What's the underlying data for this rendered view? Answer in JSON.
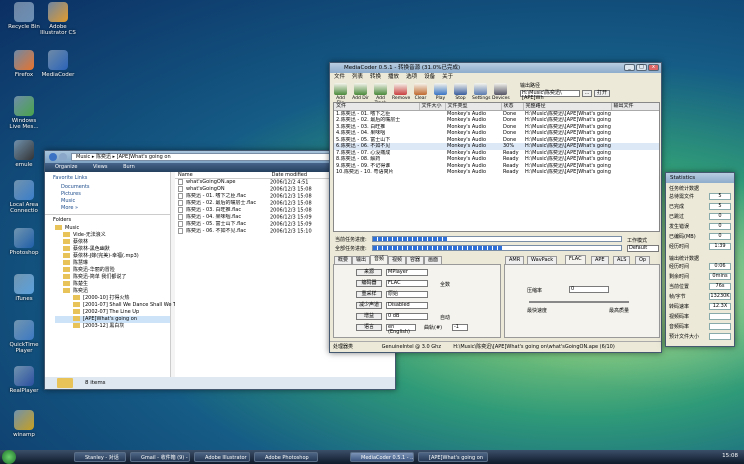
{
  "desktop_icons": [
    {
      "label": "Recycle Bin",
      "color": "#6c8fb5"
    },
    {
      "label": "Adobe Illustrator CS",
      "color": "#e39b2b"
    },
    {
      "label": "Firefox",
      "color": "#e8732c"
    },
    {
      "label": "MediaCoder",
      "color": "#2a62b8"
    },
    {
      "label": "Windows Live Mes...",
      "color": "#49a34a"
    },
    {
      "label": "emule",
      "color": "#333333"
    },
    {
      "label": "Local Area Connectio",
      "color": "#3a7dc9"
    },
    {
      "label": "Photoshop",
      "color": "#1f5ea8"
    },
    {
      "label": "iTunes",
      "color": "#5aa0dd"
    },
    {
      "label": "QuickTime Player",
      "color": "#3b78c2"
    },
    {
      "label": "RealPlayer",
      "color": "#2b4fa0"
    },
    {
      "label": "winamp",
      "color": "#c8a020"
    }
  ],
  "explorer": {
    "path": [
      "Music",
      "陈奕迅",
      "[APE]What's going on"
    ],
    "search_placeholder": "Search",
    "toolbar": [
      "Organize",
      "Views",
      "Burn"
    ],
    "fav_title": "Favorite Links",
    "fav": [
      "Documents",
      "Pictures",
      "Music",
      "More »"
    ],
    "folders_title": "Folders",
    "tree": [
      "Music",
      "Vide-无法浪义",
      "蔡依林",
      "蔡依林-黑色幽默",
      "蔡依林-J嫁(完美)-幸福(.mp3)",
      "陈慧琳",
      "陈奕迅-华丽的冒险",
      "陈奕迅-简单 我们都说了",
      "陈楚生",
      "陈奕迅",
      "[2000-10] 打得火热",
      "[2001-07] Shall We Dance Shall We Talk",
      "[2002-07] The Line Up",
      "[APE]What's going on",
      "[2003-12] 黑白灰"
    ],
    "col_name": "Name",
    "col_date": "Date modified",
    "files": [
      {
        "name": "what'sGoingON.ape",
        "date": "2006/12/2 4:51"
      },
      {
        "name": "what'sGoingON",
        "date": "2006/12/3 15:08"
      },
      {
        "name": "陈奕迅 - 01. 嗜下之臣.flac",
        "date": "2006/12/3 15:08"
      },
      {
        "name": "陈奕迅 - 02. 最后的嘴层士.flac",
        "date": "2006/12/3 15:08"
      },
      {
        "name": "陈奕迅 - 03. 白旺推.flac",
        "date": "2006/12/3 15:08"
      },
      {
        "name": "陈奕迅 - 04. 果味咽.flac",
        "date": "2006/12/3 15:09"
      },
      {
        "name": "陈奕迅 - 05. 富士山下.flac",
        "date": "2006/12/3 15:09"
      },
      {
        "name": "陈奕迅 - 06. 不如不见.flac",
        "date": "2006/12/3 15:10"
      }
    ],
    "status": "8 items"
  },
  "mediacoder": {
    "title": "MediaCoder 0.5.1 - 转换音源 (31.0%已完成)",
    "menu": [
      "文件",
      "列表",
      "转换",
      "播放",
      "选项",
      "设备",
      "关于"
    ],
    "tools": [
      "Add File",
      "Add Dir",
      "Add Track",
      "Remove",
      "Clear",
      "Play",
      "Stop",
      "Settings",
      "Devices"
    ],
    "outdir_label": "输出路径",
    "outdir_value": "H:\\Music\\陈奕迅\\[APE]Wh",
    "browse_btn": "...",
    "open_btn": "打开",
    "headers": [
      "文件",
      "文件大小",
      "文件类型",
      "状态",
      "完整路径",
      "输出文件"
    ],
    "rows": [
      {
        "file": "1.陈奕迅 - 01. 嗜下之臣",
        "type": "Monkey's Audio",
        "status": "Done",
        "path": "H:\\Music\\陈奕迅\\[APE]What's going..."
      },
      {
        "file": "2.陈奕迅 - 02. 最后的嘴层士",
        "type": "Monkey's Audio",
        "status": "Done",
        "path": "H:\\Music\\陈奕迅\\[APE]What's going..."
      },
      {
        "file": "3.陈奕迅 - 03. 白旺推",
        "type": "Monkey's Audio",
        "status": "Done",
        "path": "H:\\Music\\陈奕迅\\[APE]What's going..."
      },
      {
        "file": "4.陈奕迅 - 04. 果味咽",
        "type": "Monkey's Audio",
        "status": "Done",
        "path": "H:\\Music\\陈奕迅\\[APE]What's going..."
      },
      {
        "file": "5.陈奕迅 - 05. 富士山下",
        "type": "Monkey's Audio",
        "status": "Done",
        "path": "H:\\Music\\陈奕迅\\[APE]What's going..."
      },
      {
        "file": "6.陈奕迅 - 06. 不如不见",
        "type": "Monkey's Audio",
        "status": "30%",
        "path": "H:\\Music\\陈奕迅\\[APE]What's going..."
      },
      {
        "file": "7.陈奕迅 - 07. 心没痛成",
        "type": "Monkey's Audio",
        "status": "Ready",
        "path": "H:\\Music\\陈奕迅\\[APE]What's going..."
      },
      {
        "file": "8.陈奕迅 - 08. 解药",
        "type": "Monkey's Audio",
        "status": "Ready",
        "path": "H:\\Music\\陈奕迅\\[APE]What's going..."
      },
      {
        "file": "9.陈奕迅 - 09. 不记得谁",
        "type": "Monkey's Audio",
        "status": "Ready",
        "path": "H:\\Music\\陈奕迅\\[APE]What's going..."
      },
      {
        "file": "10.陈奕迅 - 10. 粤语简片",
        "type": "Monkey's Audio",
        "status": "Ready",
        "path": "H:\\Music\\陈奕迅\\[APE]What's going..."
      }
    ],
    "cur_progress_label": "当前任务进度:",
    "cur_progress": 0.3,
    "all_progress_label": "全部任务进度:",
    "all_progress": 0.52,
    "mode_label": "工作模式",
    "mode_value": "Default",
    "tabs_left": [
      "概要",
      "输出",
      "音频",
      "视频",
      "容器",
      "画面"
    ],
    "tabs_right": [
      "AMR",
      "WavPack",
      "FLAC",
      "APE",
      "ALS",
      "Op"
    ],
    "fields": [
      {
        "btn": "来源",
        "val": "MPlayer"
      },
      {
        "btn": "编码器",
        "val": "FLAC"
      },
      {
        "btn": "重采样",
        "val": "原始"
      },
      {
        "btn": "减少声道",
        "val": "Disabled"
      },
      {
        "btn": "增益",
        "val": "0 dB"
      },
      {
        "btn": "语言",
        "val": "en (English)"
      }
    ],
    "quanshu": "全数",
    "auto": "自动",
    "track_label": "曲轨(#)",
    "track_val": "-1",
    "compress_label": "压缩率",
    "compress_val": "0",
    "fast": "最快速度",
    "best": "最高质量",
    "status_left": "处理器类",
    "status_cpu": "GenuineIntel @ 3.0 Ghz",
    "status_file": "H:\\Music\\陈奕迅\\[APE]What's going on\\what'sGoingON.ape (6/10)"
  },
  "stats": {
    "title": "Statistics",
    "sec1": "任务统计数据",
    "items1": [
      {
        "k": "总待需文件",
        "v": "5"
      },
      {
        "k": "已完成",
        "v": "5"
      },
      {
        "k": "已跳过",
        "v": "0"
      },
      {
        "k": "发生错误",
        "v": "0"
      },
      {
        "k": "已编码(MB)",
        "v": "0"
      },
      {
        "k": "经历时间",
        "v": "1:39"
      }
    ],
    "sec2": "输出统计数据",
    "items2": [
      {
        "k": "经历时间",
        "v": "0:06"
      },
      {
        "k": "剩余时间",
        "v": "0mins"
      },
      {
        "k": "当前位置",
        "v": "76s"
      },
      {
        "k": "帧/字节",
        "v": "13230K"
      },
      {
        "k": "转码速率",
        "v": "12.3X"
      },
      {
        "k": "视频码率",
        "v": ""
      },
      {
        "k": "音频码率",
        "v": ""
      },
      {
        "k": "预计文件大小",
        "v": ""
      }
    ]
  },
  "taskbar": {
    "items": [
      "Stanley - 对话",
      "Gmail - 收件箱 (9) - ...",
      "Adobe Illustrator",
      "Adobe Photoshop",
      "MediaCoder 0.5.1 - ...",
      "[APE]What's going on"
    ],
    "clock": "15:08"
  }
}
